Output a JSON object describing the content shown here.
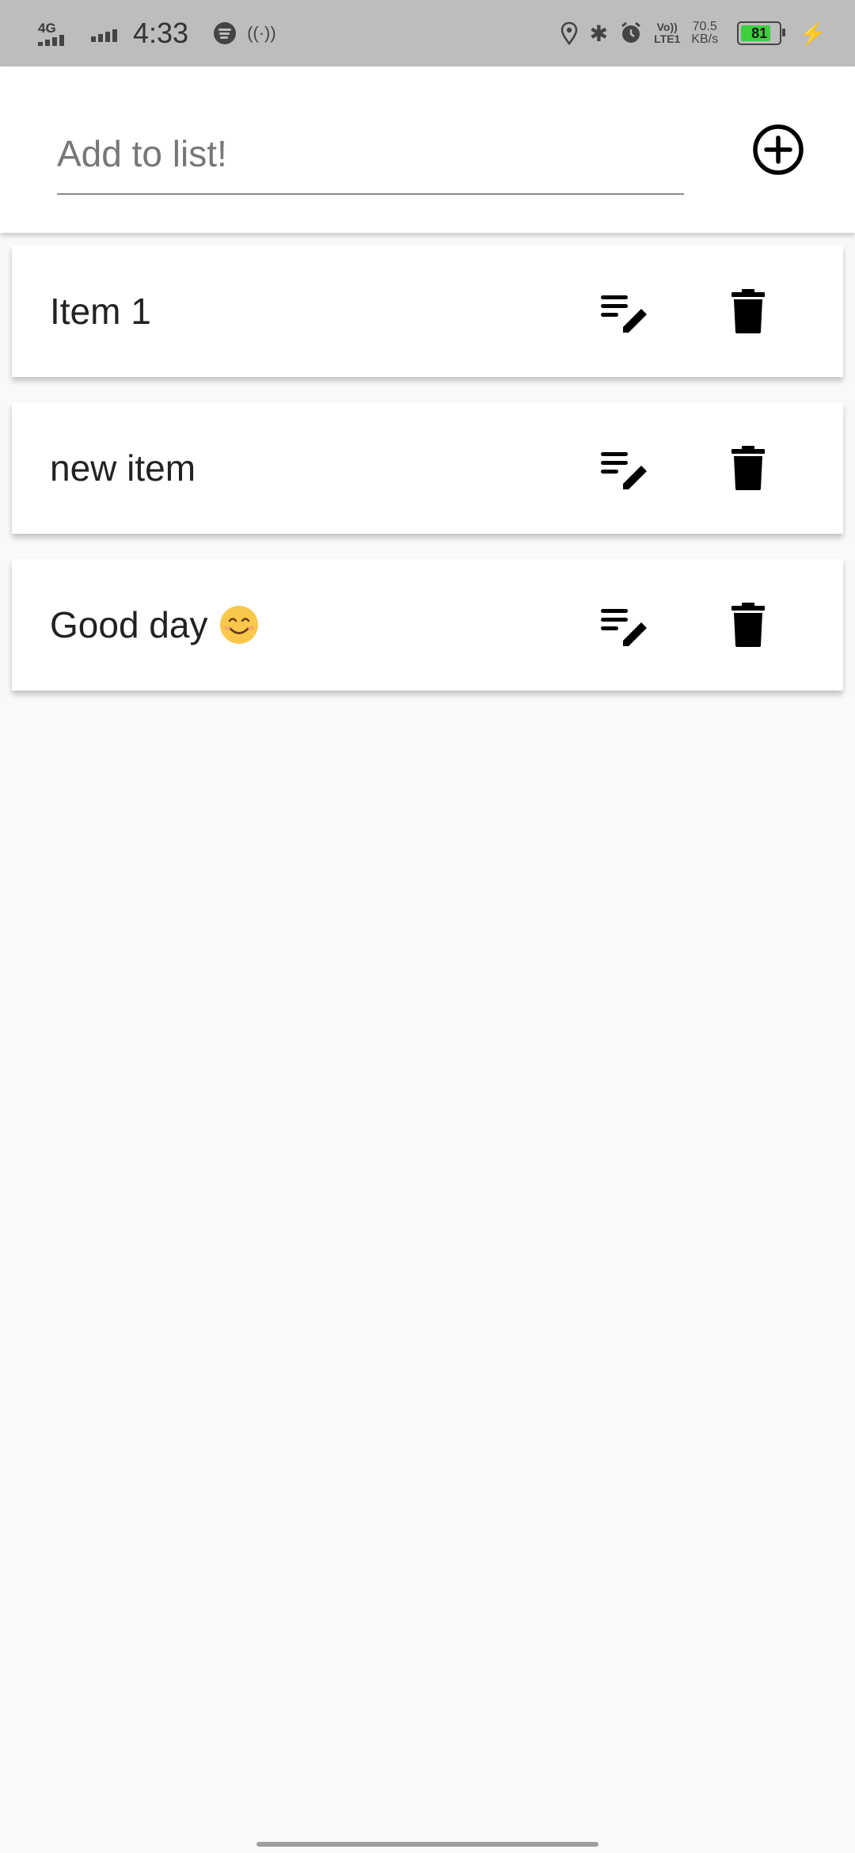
{
  "status_bar": {
    "network_type": "4G",
    "time": "4:33",
    "volte_line1": "Vo))",
    "volte_line2": "LTE1",
    "speed_value": "70.5",
    "speed_unit": "KB/s",
    "battery_level": "81",
    "battery_fraction": 0.81,
    "icons": [
      "signal-icon",
      "spotify-icon",
      "hotspot-icon",
      "location-icon",
      "bluetooth-icon",
      "alarm-icon",
      "battery-icon",
      "charging-icon"
    ]
  },
  "input": {
    "placeholder": "Add to list!",
    "value": "",
    "add_icon": "add-circle-icon"
  },
  "items": [
    {
      "label": "Item 1",
      "emoji": ""
    },
    {
      "label": "new item",
      "emoji": ""
    },
    {
      "label": "Good day",
      "emoji": "smiling-face-emoji"
    }
  ],
  "item_actions": {
    "edit_icon": "edit-note-icon",
    "delete_icon": "trash-icon"
  },
  "colors": {
    "status_bar_bg": "#bdbdbd",
    "page_bg": "#f9f9f9",
    "card_bg": "#ffffff",
    "battery_fill": "#3ecf3e",
    "charge_icon": "#f3d23c"
  }
}
